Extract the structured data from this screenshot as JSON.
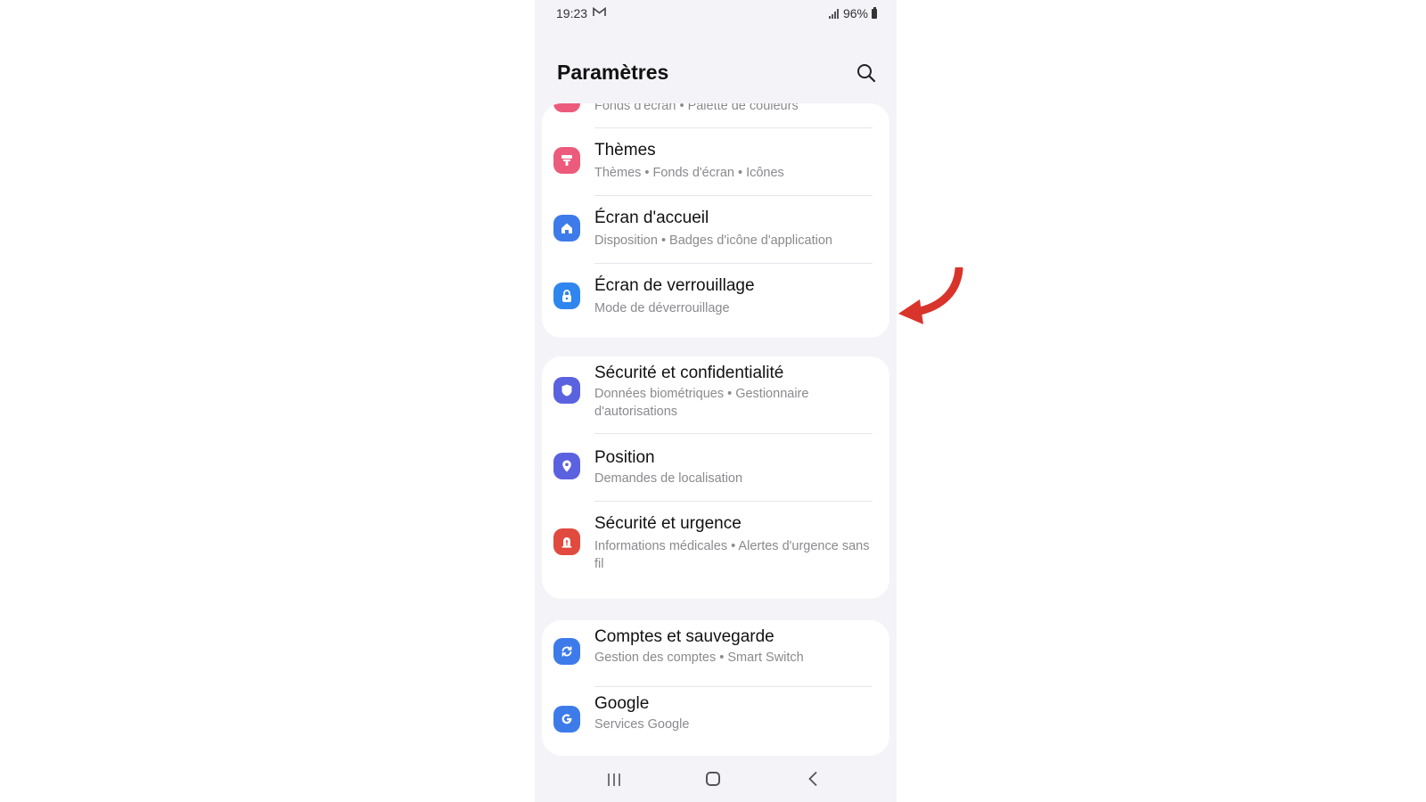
{
  "status": {
    "time": "19:23",
    "battery": "96%"
  },
  "header": {
    "title": "Paramètres"
  },
  "partial_item": {
    "subtitle": "Fonds d'écran  •  Palette de couleurs"
  },
  "groups": [
    {
      "items": [
        {
          "title": "Thèmes",
          "subtitle": "Thèmes  •  Fonds d'écran  •  Icônes",
          "icon": "themes-icon",
          "color": "#ec5b7b"
        },
        {
          "title": "Écran d'accueil",
          "subtitle": "Disposition  •  Badges d'icône d'application",
          "icon": "home-icon",
          "color": "#3d7bea"
        },
        {
          "title": "Écran de verrouillage",
          "subtitle": "Mode de déverrouillage",
          "icon": "lock-icon",
          "color": "#2f86ee"
        }
      ]
    },
    {
      "items": [
        {
          "title": "Sécurité et confidentialité",
          "subtitle": "Données biométriques  •  Gestionnaire d'autorisations",
          "icon": "shield-icon",
          "color": "#5b62e0"
        },
        {
          "title": "Position",
          "subtitle": "Demandes de localisation",
          "icon": "location-pin-icon",
          "color": "#5b62e0"
        },
        {
          "title": "Sécurité et urgence",
          "subtitle": "Informations médicales  •  Alertes d'urgence sans fil",
          "icon": "emergency-icon",
          "color": "#e04a3f"
        }
      ]
    },
    {
      "items": [
        {
          "title": "Comptes et sauvegarde",
          "subtitle": "Gestion des comptes  •  Smart Switch",
          "icon": "sync-icon",
          "color": "#3d7bea"
        },
        {
          "title": "Google",
          "subtitle": "Services Google",
          "icon": "google-icon",
          "color": "#3d7bea"
        }
      ]
    }
  ],
  "colors": {
    "accent_arrow": "#d9342b",
    "background": "#f4f3f8",
    "card": "#ffffff"
  }
}
